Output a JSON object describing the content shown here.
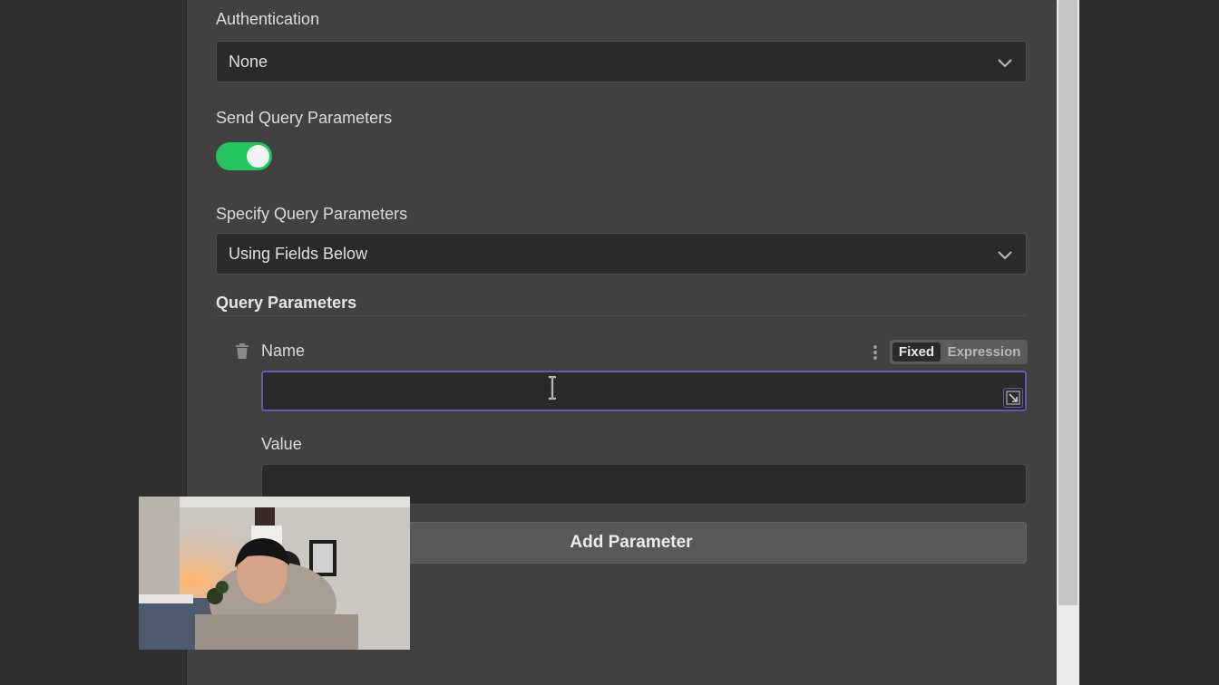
{
  "form": {
    "authentication": {
      "label": "Authentication",
      "value": "None"
    },
    "send_query_parameters": {
      "label": "Send Query Parameters",
      "enabled": true
    },
    "specify_query_parameters": {
      "label": "Specify Query Parameters",
      "value": "Using Fields Below"
    },
    "query_parameters": {
      "section_title": "Query Parameters",
      "parameters": [
        {
          "name_label": "Name",
          "name_value": "",
          "value_label": "Value",
          "value_value": ""
        }
      ],
      "mode_options": [
        "Fixed",
        "Expression"
      ],
      "mode_selected": "Fixed",
      "add_button_label": "Add Parameter"
    }
  },
  "colors": {
    "panel_bg": "#414141",
    "input_bg": "#2a2a2a",
    "toggle_on": "#22c55e",
    "focus_border": "#6a5aae"
  },
  "icons": [
    "chevron-down-icon",
    "trash-icon",
    "kebab-menu-icon",
    "expand-icon",
    "text-cursor-icon"
  ],
  "overlay": {
    "type": "webcam-feed"
  }
}
